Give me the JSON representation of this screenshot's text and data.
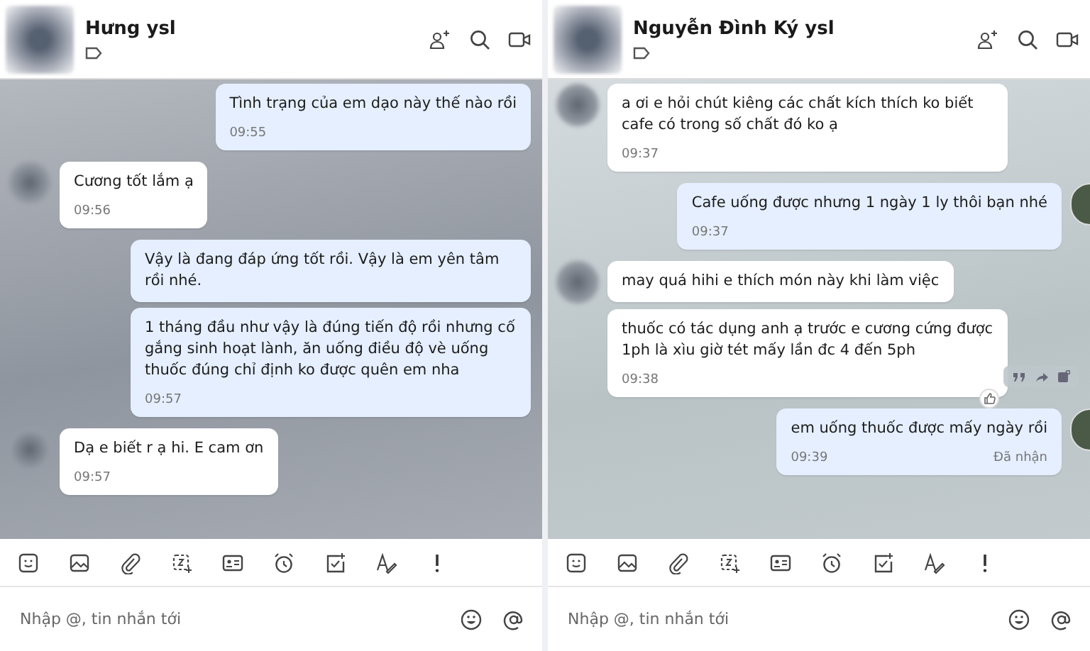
{
  "panels": [
    {
      "contact_name": "Hưng ysl",
      "own_avatar": false,
      "messages": [
        {
          "kind": "out",
          "text": "Tình trạng của em dạo này thế nào rồi",
          "time": "09:55"
        },
        {
          "kind": "in",
          "text": "Cương tốt lắm ạ",
          "time": "09:56"
        },
        {
          "kind": "out",
          "text": "Vậy là đang đáp ứng tốt rồi. Vậy là em yên tâm rồi nhé."
        },
        {
          "kind": "out",
          "text": "1 tháng đầu như vậy là đúng tiến độ rồi nhưng cố gắng sinh hoạt lành, ăn uống điều độ vè uống thuốc đúng chỉ định ko được quên em nha",
          "time": "09:57"
        },
        {
          "kind": "in",
          "text": "Dạ e biết r ạ hi. E cam ơn",
          "time": "09:57"
        }
      ],
      "input": {
        "placeholder": "Nhập @, tin nhắn tới"
      }
    },
    {
      "contact_name": "Nguyễn Đình Ký ysl",
      "own_avatar": true,
      "messages": [
        {
          "kind": "in",
          "text": "a ơi e hỏi chút kiêng các chất kích thích ko biết cafe có trong số chất đó ko ạ",
          "time": "09:37"
        },
        {
          "kind": "out",
          "text": "Cafe uống được nhưng 1 ngày 1 ly thôi bạn nhé",
          "time": "09:37"
        },
        {
          "kind": "in",
          "text": "may quá hihi e thích món này khi làm việc"
        },
        {
          "kind": "in",
          "text": "thuốc có tác dụng anh ạ trước e cương cứng được 1ph là xìu giờ tét mấy lần đc 4 đến 5ph",
          "time": "09:38",
          "liked": true,
          "show_actions": true
        },
        {
          "kind": "out",
          "text": "em uống thuốc được mấy ngày rồi",
          "time": "09:39",
          "status": "Đã nhận"
        }
      ],
      "input": {
        "placeholder": "Nhập @, tin nhắn tới"
      }
    }
  ]
}
